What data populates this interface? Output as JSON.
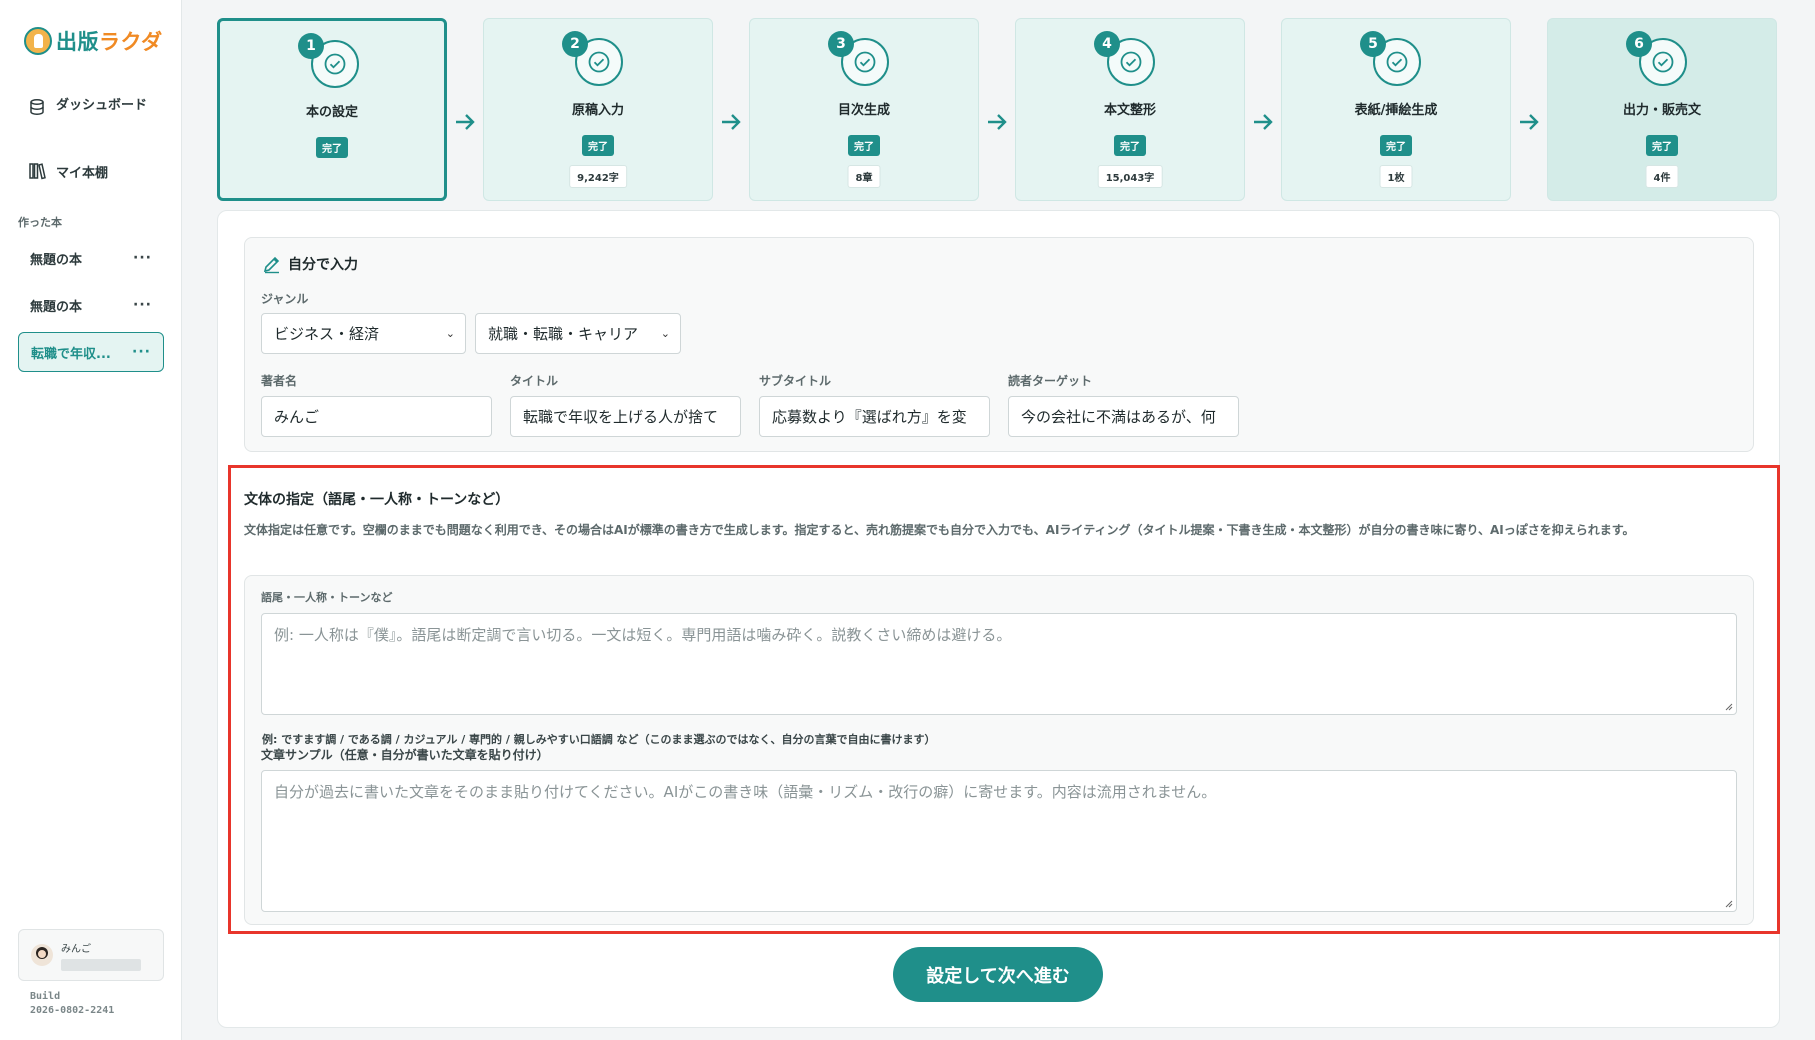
{
  "app": {
    "logo_main": "出版",
    "logo_accent": "ラクダ"
  },
  "sidebar": {
    "nav": [
      {
        "label": "ダッシュボード",
        "icon": "database-icon"
      },
      {
        "label": "マイ本棚",
        "icon": "bookshelf-icon"
      }
    ],
    "section_label": "作った本",
    "books": [
      {
        "label": "無題の本",
        "more": "···",
        "active": false
      },
      {
        "label": "無題の本",
        "more": "···",
        "active": false
      },
      {
        "label": "転職で年収...",
        "more": "···",
        "active": true
      }
    ],
    "user": {
      "name": "みんご",
      "email_masked": ""
    },
    "build_label": "Build",
    "build_version": "2026-0802-2241"
  },
  "steps": [
    {
      "num": "1",
      "title": "本の設定",
      "badge": "完了",
      "meta": ""
    },
    {
      "num": "2",
      "title": "原稿入力",
      "badge": "完了",
      "meta": "9,242字"
    },
    {
      "num": "3",
      "title": "目次生成",
      "badge": "完了",
      "meta": "8章"
    },
    {
      "num": "4",
      "title": "本文整形",
      "badge": "完了",
      "meta": "15,043字"
    },
    {
      "num": "5",
      "title": "表紙/挿絵生成",
      "badge": "完了",
      "meta": "1枚"
    },
    {
      "num": "6",
      "title": "出力・販売文",
      "badge": "完了",
      "meta": "4件"
    }
  ],
  "form": {
    "heading": "自分で入力",
    "genre_label": "ジャンル",
    "genre_value": "ビジネス・経済",
    "subgenre_value": "就職・転職・キャリア",
    "author_label": "著者名",
    "author_value": "みんご",
    "title_label": "タイトル",
    "title_value": "転職で年収を上げる人が捨て",
    "subtitle_label": "サブタイトル",
    "subtitle_value": "応募数より『選ばれ方』を変",
    "target_label": "読者ターゲット",
    "target_value": "今の会社に不満はあるが、何"
  },
  "style": {
    "title": "文体の指定（語尾・一人称・トーンなど）",
    "description": "文体指定は任意です。空欄のままでも問題なく利用でき、その場合はAIが標準の書き方で生成します。指定すると、売れ筋提案でも自分で入力でも、AIライティング（タイトル提案・下書き生成・本文整形）が自分の書き味に寄り、AIっぽさを抑えられます。",
    "tone_label": "語尾・一人称・トーンなど",
    "tone_placeholder": "例: 一人称は『僕』。語尾は断定調で言い切る。一文は短く。専門用語は噛み砕く。説教くさい締めは避ける。",
    "hint": "例: ですます調 / である調 / カジュアル / 専門的 / 親しみやすい口語調 など（このまま選ぶのではなく、自分の言葉で自由に書けます）",
    "sample_label": "文章サンプル（任意・自分が書いた文章を貼り付け）",
    "sample_placeholder": "自分が過去に書いた文章をそのまま貼り付けてください。AIがこの書き味（語彙・リズム・改行の癖）に寄せます。内容は流用されません。"
  },
  "cta": {
    "label": "設定して次へ進む"
  },
  "colors": {
    "accent": "#1f8f8a",
    "highlight": "#e8352b",
    "logo_orange": "#f08a24"
  }
}
